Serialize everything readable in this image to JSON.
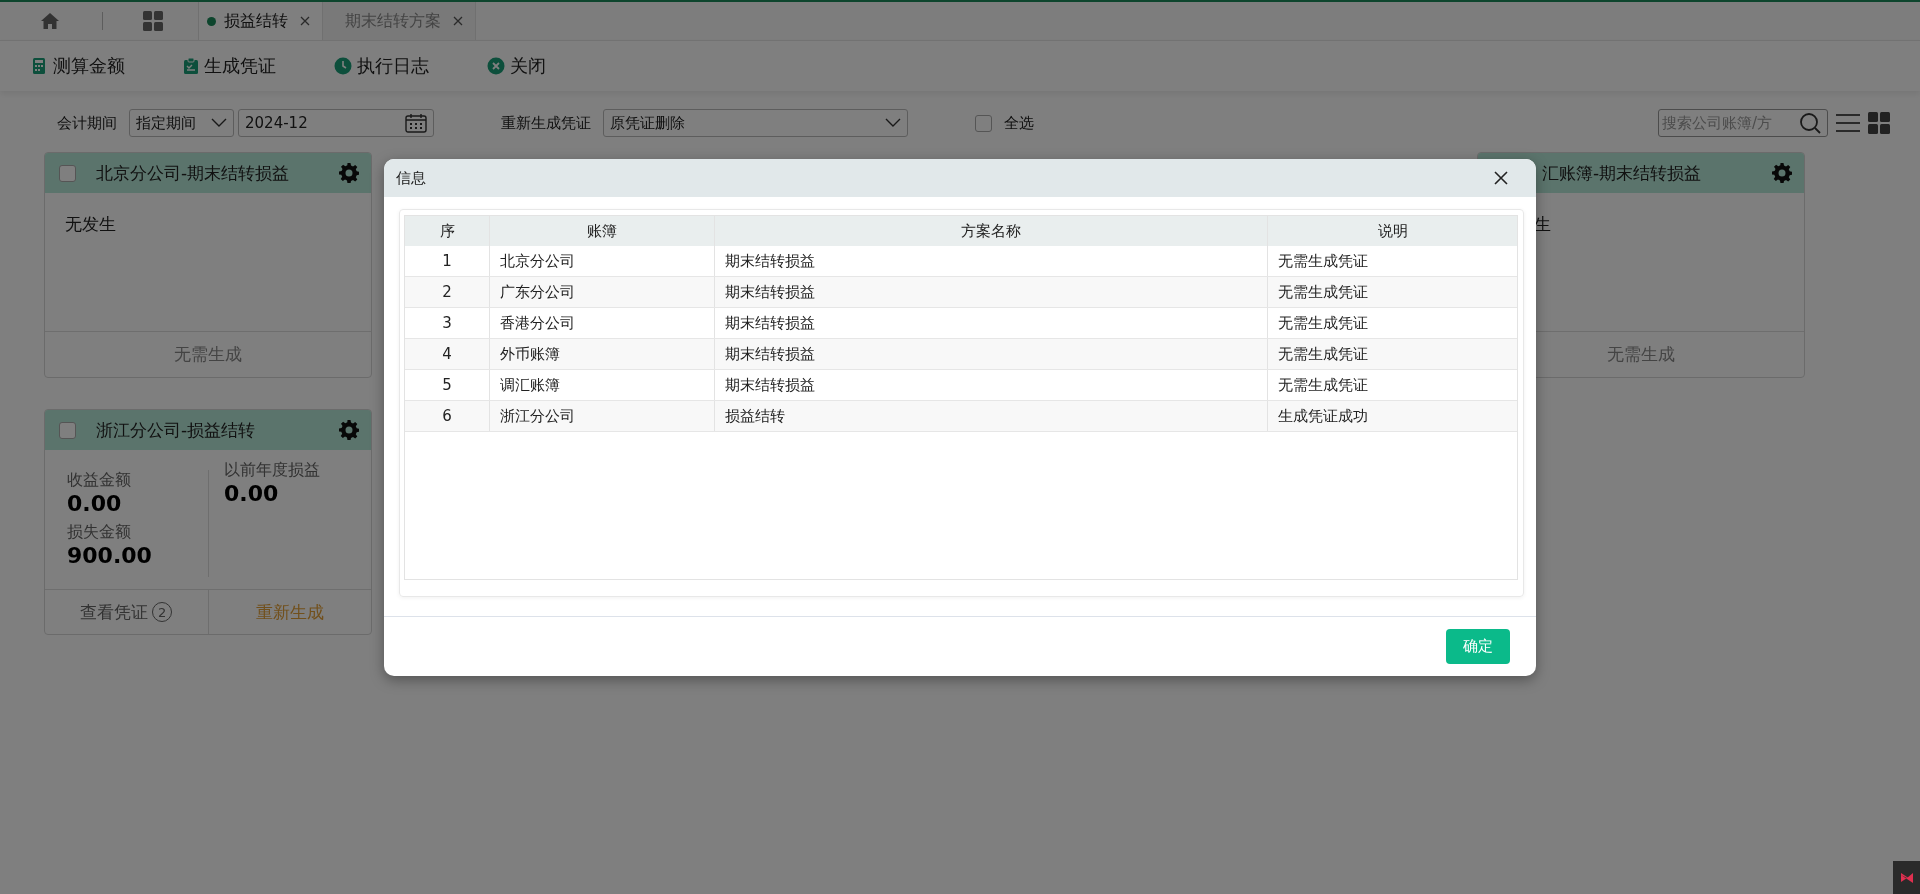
{
  "tabs": [
    {
      "label": "损益结转",
      "selected": true
    },
    {
      "label": "期末结转方案",
      "selected": false
    }
  ],
  "toolbar": [
    {
      "kind": "calc",
      "label": "测算金额"
    },
    {
      "kind": "voucher",
      "label": "生成凭证"
    },
    {
      "kind": "log",
      "label": "执行日志"
    },
    {
      "kind": "close",
      "label": "关闭"
    }
  ],
  "filters": {
    "period_label": "会计期间",
    "period_mode": "指定期间",
    "period_value": "2024-12",
    "regen_label": "重新生成凭证",
    "regen_value": "原凭证删除",
    "select_all": {
      "label": "全选",
      "checked": false
    },
    "search": {
      "placeholder": "搜索公司账簿/方"
    }
  },
  "card_rows": [
    [
      {
        "kind": "plain",
        "title": "北京分公司-期末结转损益",
        "checked": false,
        "body": "无发生",
        "footer": "无需生成"
      },
      {
        "kind": "cut",
        "title": "汇账簿-期末结转损益",
        "body": "生",
        "footer": "无需生成"
      }
    ],
    [
      {
        "kind": "amounts",
        "title": "浙江分公司-损益结转",
        "checked": false,
        "left": [
          {
            "label": "收益金额",
            "value": "0.00"
          },
          {
            "label": "损失金额",
            "value": "900.00"
          }
        ],
        "right": [
          {
            "label": "以前年度损益",
            "value": "0.00"
          }
        ],
        "view_label": "查看凭证",
        "view_count": "2",
        "regen": "重新生成"
      }
    ]
  ],
  "dialog": {
    "title": "信息",
    "columns": [
      "序",
      "账簿",
      "方案名称",
      "说明"
    ],
    "rows": [
      [
        "1",
        "北京分公司",
        "期末结转损益",
        "无需生成凭证"
      ],
      [
        "2",
        "广东分公司",
        "期末结转损益",
        "无需生成凭证"
      ],
      [
        "3",
        "香港分公司",
        "期末结转损益",
        "无需生成凭证"
      ],
      [
        "4",
        "外币账簿",
        "期末结转损益",
        "无需生成凭证"
      ],
      [
        "5",
        "调汇账簿",
        "期末结转损益",
        "无需生成凭证"
      ],
      [
        "6",
        "浙江分公司",
        "损益结转",
        "生成凭证成功"
      ]
    ],
    "ok": "确定"
  }
}
